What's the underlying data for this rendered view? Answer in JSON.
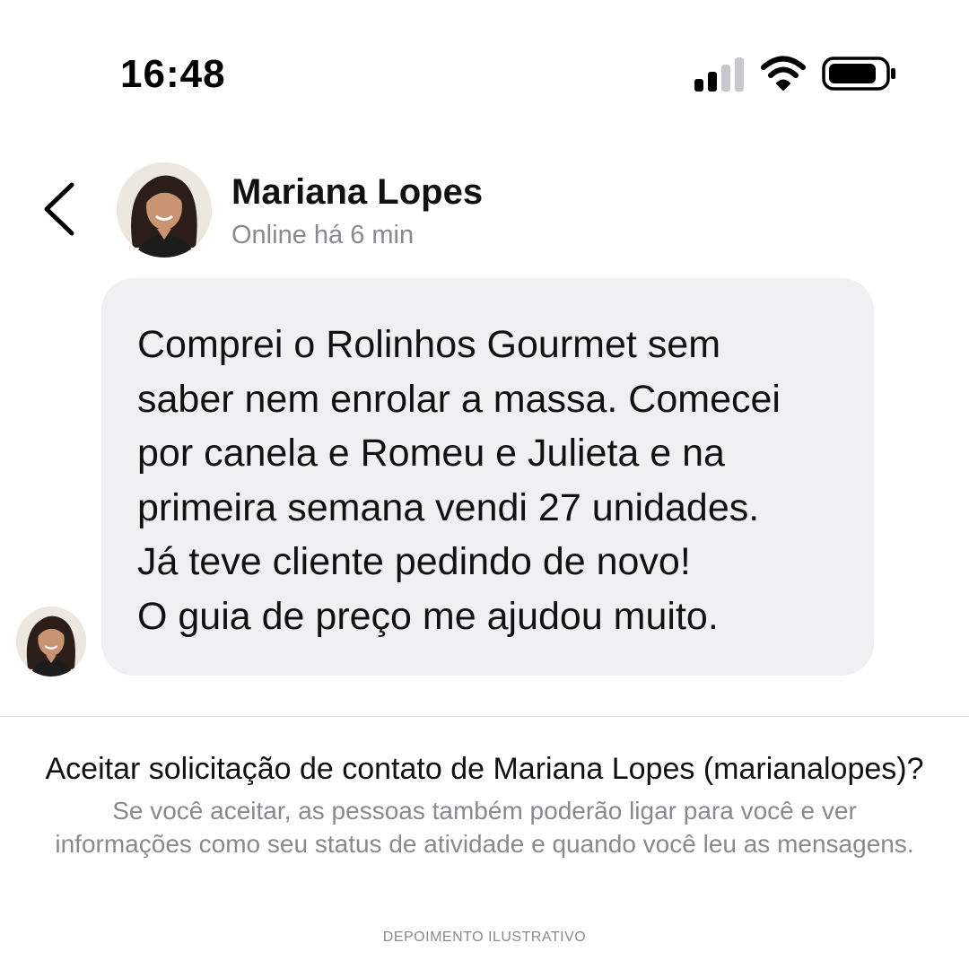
{
  "status_bar": {
    "time": "16:48",
    "icons": [
      "cellular-signal-icon",
      "wifi-icon",
      "battery-icon"
    ]
  },
  "header": {
    "back_icon": "chevron-left-icon",
    "contact_name": "Mariana Lopes",
    "contact_status": "Online há 6 min"
  },
  "message": {
    "text": "Comprei o Rolinhos Gourmet sem\nsaber nem enrolar a massa. Comecei\npor canela e Romeu e Julieta e na\nprimeira semana vendi 27 unidades.\nJá teve cliente pedindo de novo!\nO guia de preço me ajudou muito."
  },
  "request": {
    "title": "Aceitar solicitação de contato de Mariana Lopes (marianalopes)?",
    "description": "Se você aceitar, as pessoas também poderão ligar para você e ver informações como seu status de atividade e quando você leu as mensagens."
  },
  "footer": {
    "note": "DEPOIMENTO ILUSTRATIVO"
  },
  "colors": {
    "bubble": "#f0f0f2",
    "secondary_text": "#8a8a8e",
    "primary_text": "#111111"
  }
}
